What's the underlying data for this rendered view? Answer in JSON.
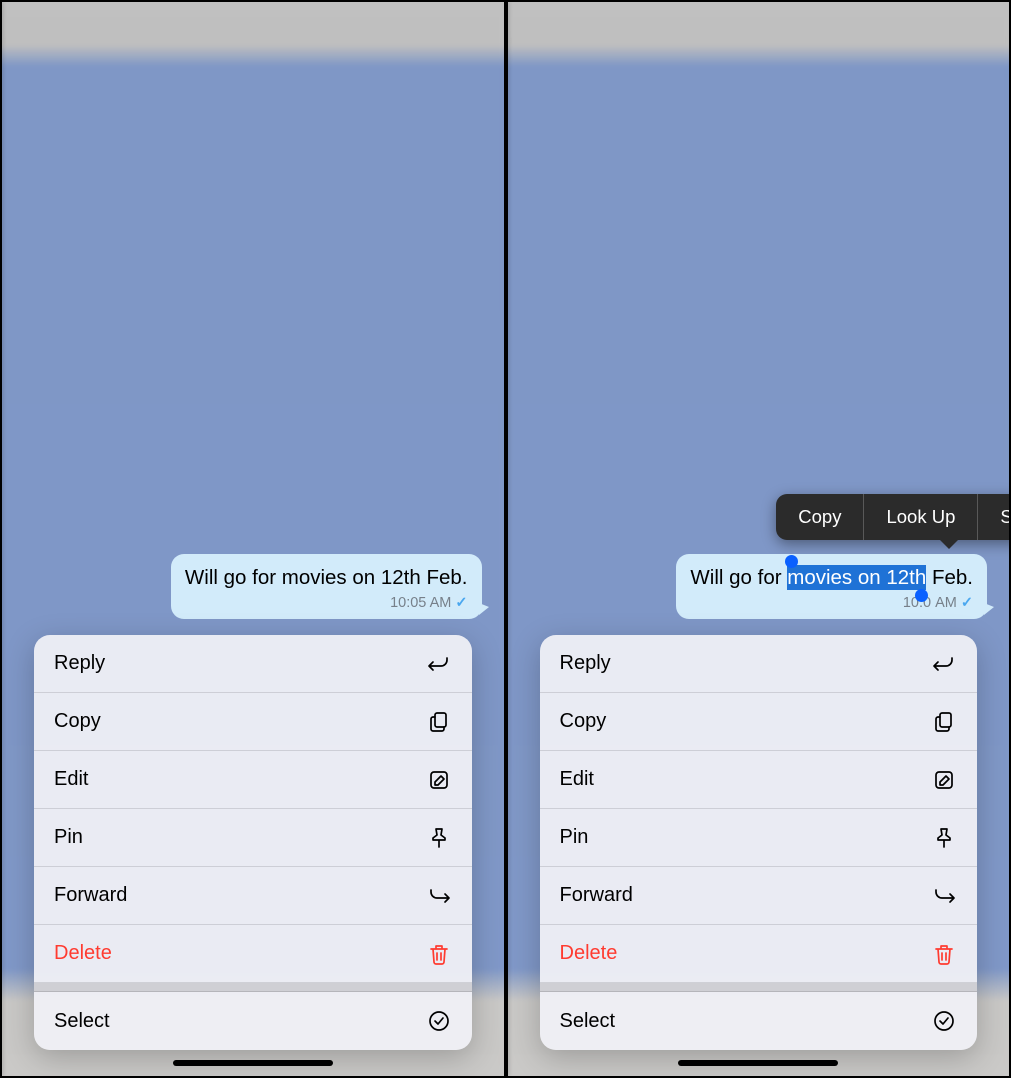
{
  "message": {
    "prefix": "Will go for ",
    "selection": "movies on 12th",
    "suffix": " Feb.",
    "full_text": "Will go for movies on 12th Feb.",
    "time": "10:05 AM",
    "time_partial": "10:0",
    "time_suffix": " AM",
    "status_icon": "sent-check"
  },
  "menu": {
    "reply": {
      "label": "Reply",
      "icon": "reply-icon"
    },
    "copy": {
      "label": "Copy",
      "icon": "copy-icon"
    },
    "edit": {
      "label": "Edit",
      "icon": "edit-icon"
    },
    "pin": {
      "label": "Pin",
      "icon": "pin-icon"
    },
    "forward": {
      "label": "Forward",
      "icon": "forward-icon"
    },
    "delete": {
      "label": "Delete",
      "icon": "trash-icon"
    },
    "select": {
      "label": "Select",
      "icon": "select-icon"
    }
  },
  "callout": {
    "copy": "Copy",
    "lookup": "Look Up",
    "share": "Share"
  }
}
